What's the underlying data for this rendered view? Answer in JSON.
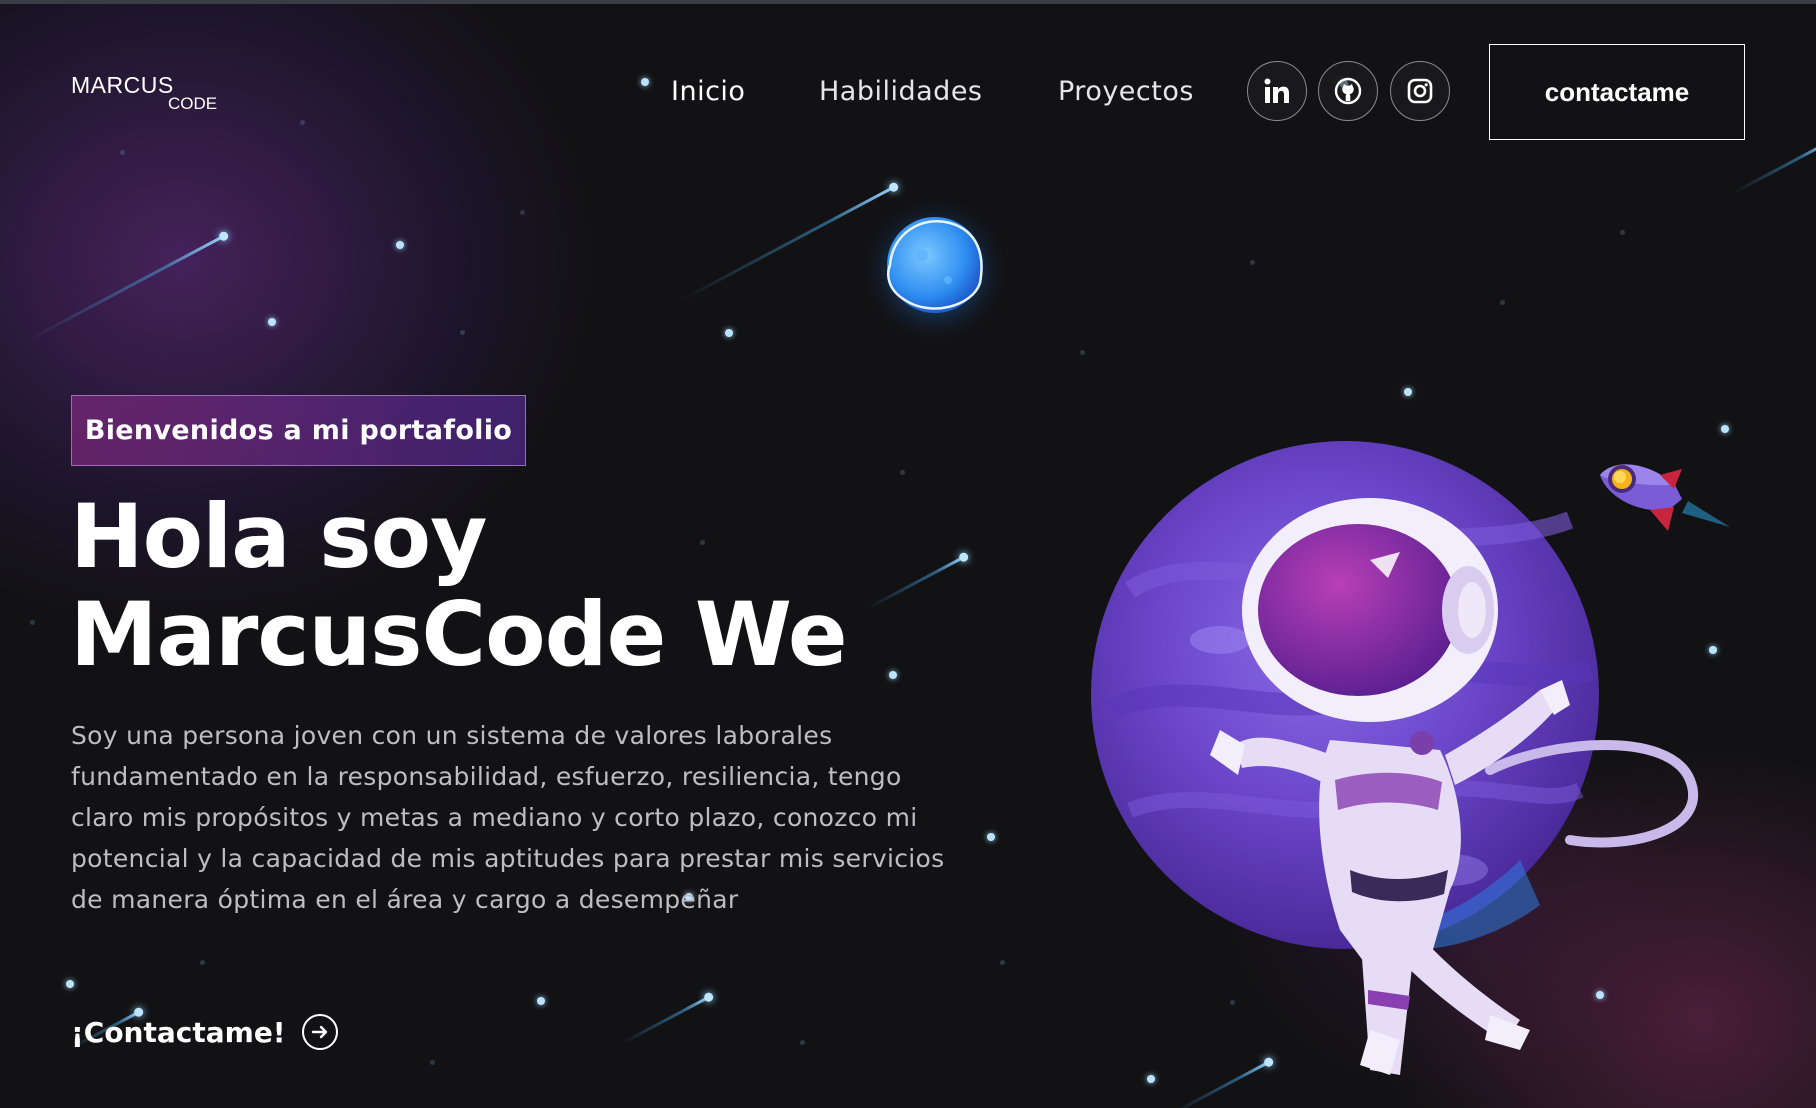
{
  "logo": {
    "line1": "MARCUS",
    "line2": "CODE"
  },
  "nav": {
    "links": [
      {
        "label": "Inicio"
      },
      {
        "label": "Habilidades"
      },
      {
        "label": "Proyectos"
      }
    ],
    "socials": [
      {
        "icon": "linkedin-icon"
      },
      {
        "icon": "github-icon"
      },
      {
        "icon": "instagram-icon"
      }
    ],
    "contact_button": "contactame"
  },
  "hero": {
    "tagline": "Bienvenidos a mi portafolio",
    "headline_line1": "Hola soy",
    "headline_line2": "MarcusCode We",
    "bio": "Soy una persona joven con un sistema de valores laborales fundamentado en la responsabilidad, esfuerzo, resiliencia, tengo claro mis propósitos y metas a mediano y corto plazo, conozco mi potencial y la capacidad de mis aptitudes para prestar mis servicios de manera óptima en el área y cargo a desempeñar",
    "cta": "¡Contactame!"
  },
  "colors": {
    "background": "#121214",
    "accent_purple": "#7b4fd1",
    "star_blue": "#b9e4ff"
  }
}
